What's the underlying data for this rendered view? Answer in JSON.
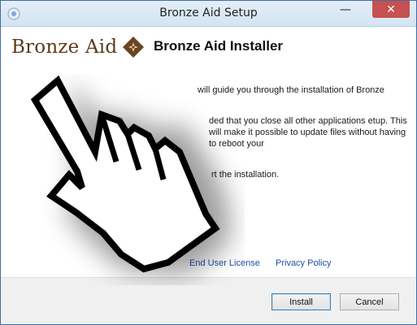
{
  "window": {
    "title": "Bronze Aid Setup"
  },
  "titlebar": {
    "minimize_glyph": "—",
    "close_glyph": "✕"
  },
  "logo": {
    "text": "Bronze Aid"
  },
  "header": {
    "title": "Bronze Aid Installer"
  },
  "body": {
    "paragraph1": "will guide you through the installation of Bronze",
    "paragraph2": "ded that you close all other applications etup. This will make it possible to update files without having to reboot your",
    "paragraph3": "rt the installation."
  },
  "links": {
    "eula": "End User License",
    "privacy": "Privacy Policy"
  },
  "buttons": {
    "install": "Install",
    "cancel": "Cancel"
  },
  "colors": {
    "titlebar": "#d9e7f6",
    "close": "#c75050",
    "logo_brown": "#5b3a1b",
    "link": "#1f4fa6"
  }
}
